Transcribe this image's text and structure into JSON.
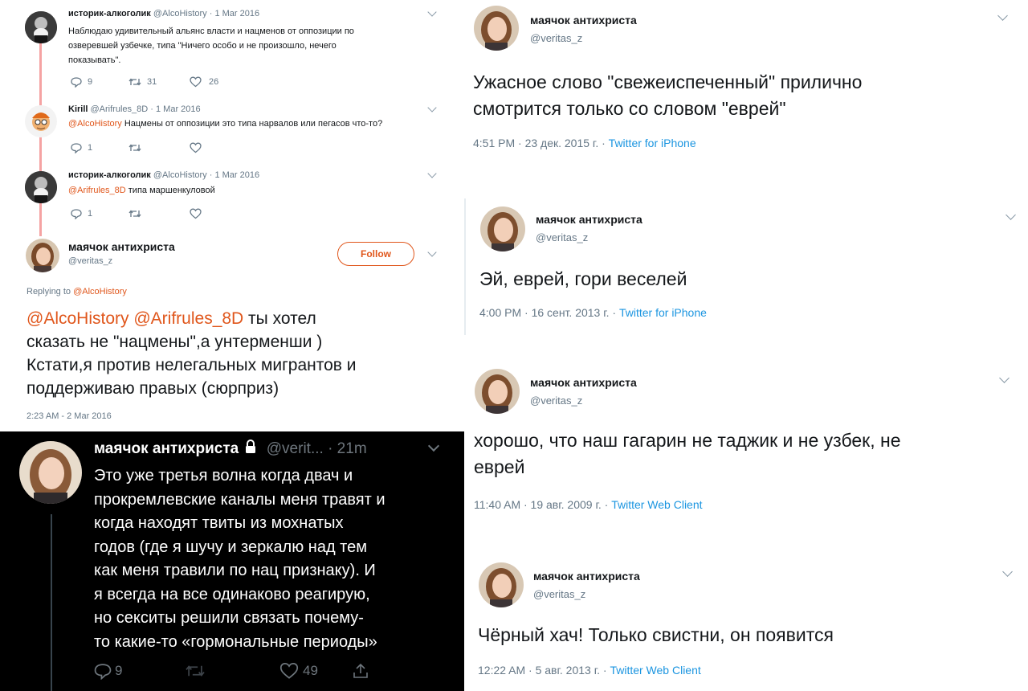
{
  "colors": {
    "link_blue": "#1b95e0",
    "mention_orange": "#e0561b",
    "follow_orange": "#e0561b",
    "dark_bg": "#000000",
    "thread_line": "#f5a3a3"
  },
  "thread": {
    "tweet1": {
      "name": "историк-алкоголик",
      "handle": "@AlcoHistory",
      "date": "· 1 Mar 2016",
      "text_l1": "Наблюдаю удивительный альянс власти и нацменов от оппозиции по",
      "text_l2": "озверевшей узбечке, типа \"Ничего особо и не произошло, нечего",
      "text_l3": "показывать\".",
      "replies": "9",
      "retweets": "31",
      "likes": "26"
    },
    "tweet2": {
      "name": "Kirill",
      "handle": "@Arifrules_8D",
      "date": "· 1 Mar 2016",
      "mention": "@AlcoHistory",
      "text": " Нацмены от оппозиции это типа нарвалов или пегасов что-то?",
      "replies": "1"
    },
    "tweet3": {
      "name": "историк-алкоголик",
      "handle": "@AlcoHistory",
      "date": "· 1 Mar 2016",
      "mention": "@Arifrules_8D",
      "text": " типа маршенкуловой",
      "replies": "1"
    },
    "main": {
      "name": "маячок антихриста",
      "handle": "@veritas_z",
      "follow_label": "Follow",
      "replying_prefix": "Replying to ",
      "replying_to": "@AlcoHistory",
      "mention1": "@AlcoHistory",
      "mention2": "@Arifrules_8D",
      "text_l1": " ты хотел",
      "text_l2": "сказать не \"нацмены\",а унтерменши )",
      "text_l3": "Кстати,я против нелегальных мигрантов и",
      "text_l4": "поддерживаю правых (сюрприз)",
      "timestamp": "2:23 AM - 2 Mar 2016"
    }
  },
  "dark_tweet": {
    "name": "маячок антихриста",
    "handle": "@verit...",
    "time": "· 21m",
    "lines": [
      "Это уже третья волна когда двач и",
      "прокремлевские каналы меня травят и",
      "когда находят твиты из мохнатых",
      "годов (где я шучу и зеркалю над тем",
      "как меня травили по нац признаку). И",
      "я всегда на все одинаково реагирую,",
      "но секситы решили связать почему-",
      "то какие-то «гормональные периоды»"
    ],
    "replies": "9",
    "likes": "49"
  },
  "right_tweets": [
    {
      "name": "маячок антихриста",
      "handle": "@veritas_z",
      "line1": "Ужасное слово \"свежеиспеченный\" прилично",
      "line2": "смотрится только со словом \"еврей\"",
      "date": "4:51 PM · 23 дек. 2015 г. · ",
      "source": "Twitter for iPhone"
    },
    {
      "name": "маячок антихриста",
      "handle": "@veritas_z",
      "line1": "Эй, еврей, гори веселей",
      "date": "4:00 PM · 16 сент. 2013 г. · ",
      "source": "Twitter for iPhone"
    },
    {
      "name": "маячок антихриста",
      "handle": "@veritas_z",
      "line1": "хорошо, что наш гагарин не таджик и не узбек, не",
      "line2": "еврей",
      "date": "11:40 AM · 19 авг. 2009 г. · ",
      "source": "Twitter Web Client"
    },
    {
      "name": "маячок антихриста",
      "handle": "@veritas_z",
      "line1": "Чёрный хач! Только свистни, он появится",
      "date": "12:22 AM · 5 авг. 2013 г. · ",
      "source": "Twitter Web Client"
    }
  ]
}
